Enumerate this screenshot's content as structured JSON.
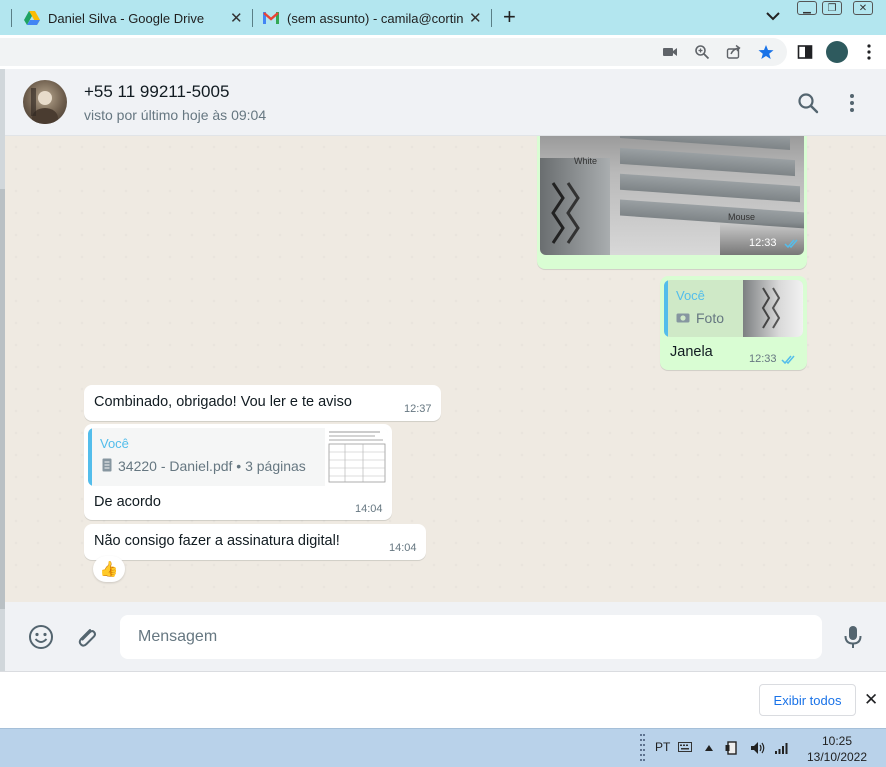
{
  "browser": {
    "tabs": [
      {
        "title": "Daniel Silva - Google Drive",
        "icon": "google-drive-icon"
      },
      {
        "title": "(sem assunto) - camila@cortinat",
        "icon": "gmail-icon"
      }
    ]
  },
  "chat": {
    "contact_name": "+55 11 99211-5005",
    "contact_status": "visto por último hoje às 09:04",
    "messages": [
      {
        "type": "image",
        "direction": "out",
        "time": "12:33",
        "labels": [
          "White",
          "Mouse"
        ]
      },
      {
        "type": "reply",
        "direction": "out",
        "quoted_author": "Você",
        "quoted_desc": "Foto",
        "text": "Janela",
        "time": "12:33"
      },
      {
        "type": "text",
        "direction": "in",
        "text": "Combinado, obrigado! Vou ler e te aviso",
        "time": "12:37"
      },
      {
        "type": "reply",
        "direction": "in",
        "quoted_author": "Você",
        "quoted_desc": "34220 - Daniel.pdf • 3 páginas",
        "text": "De acordo",
        "time": "14:04"
      },
      {
        "type": "text",
        "direction": "in",
        "text": "Não consigo fazer a assinatura digital!",
        "time": "14:04",
        "reaction": "👍"
      }
    ],
    "composer": {
      "placeholder": "Mensagem"
    }
  },
  "downloads_bar": {
    "show_all_label": "Exibir todos"
  },
  "taskbar": {
    "language": "PT",
    "time": "10:25",
    "date": "13/10/2022"
  },
  "colors": {
    "accent": "#53bdeb",
    "outgoing": "#d9fdd3",
    "incoming": "#ffffff",
    "tabstrip": "#b3e6ef"
  }
}
